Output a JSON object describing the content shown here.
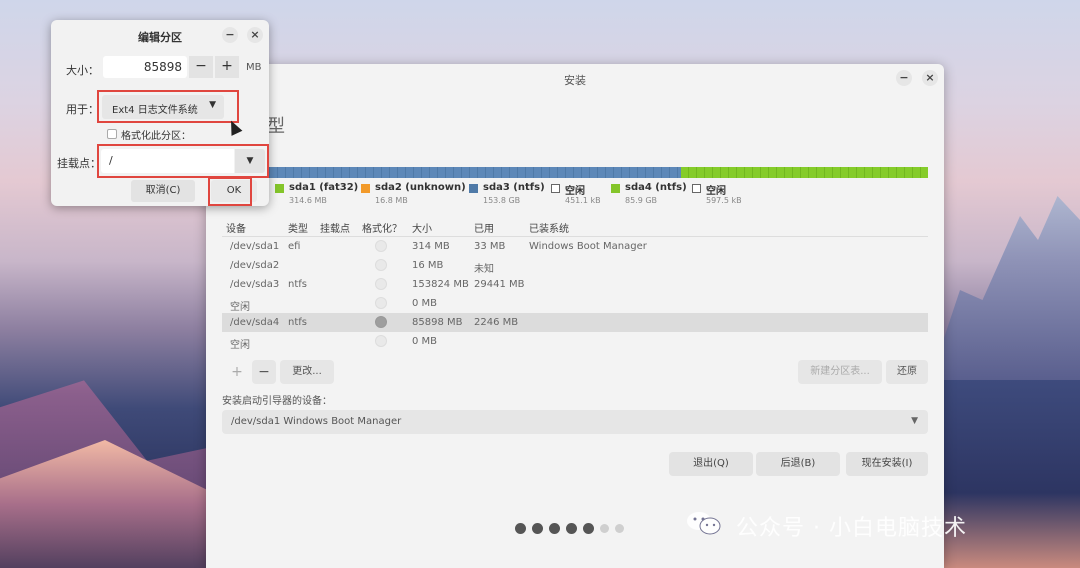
{
  "dialog": {
    "title": "编辑分区",
    "size_label": "大小：",
    "size_value": "85898",
    "size_unit": "MB",
    "minus": "−",
    "plus": "+",
    "minimize": "−",
    "close": "×",
    "use_label": "用于：",
    "use_value": "Ext4 日志文件系统",
    "format_label": "格式化此分区：",
    "format_checked": false,
    "mount_label": "挂载点：",
    "mount_value": "/",
    "cancel": "取消(C)",
    "ok": "OK"
  },
  "main": {
    "title": "安装",
    "heading": "类型",
    "minimize": "−",
    "close": "×",
    "legend": [
      {
        "name": "sda1 (fat32)",
        "size": "314.6 MB",
        "color": "#84c52a",
        "empty": false
      },
      {
        "name": "sda2 (unknown)",
        "size": "16.8 MB",
        "color": "#f29a2a",
        "empty": false
      },
      {
        "name": "sda3 (ntfs)",
        "size": "153.8 GB",
        "color": "#4f7aa8",
        "empty": false
      },
      {
        "name": "空闲",
        "size": "451.1 kB",
        "color": "#ffffff",
        "empty": true
      },
      {
        "name": "sda4 (ntfs)",
        "size": "85.9 GB",
        "color": "#84c52a",
        "empty": false
      },
      {
        "name": "空闲",
        "size": "597.5 kB",
        "color": "#ffffff",
        "empty": true
      }
    ],
    "columns": [
      "设备",
      "类型",
      "挂载点",
      "格式化？",
      "大小",
      "已用",
      "已装系统"
    ],
    "rows": [
      {
        "device": "/dev/sda1",
        "type": "efi",
        "mount": "",
        "size": "314 MB",
        "used": "33 MB",
        "system": "Windows Boot Manager"
      },
      {
        "device": "/dev/sda2",
        "type": "",
        "mount": "",
        "size": "16 MB",
        "used": "未知",
        "system": ""
      },
      {
        "device": "/dev/sda3",
        "type": "ntfs",
        "mount": "",
        "size": "153824 MB",
        "used": "29441 MB",
        "system": ""
      },
      {
        "device": "空闲",
        "type": "",
        "mount": "",
        "size": "0 MB",
        "used": "",
        "system": ""
      },
      {
        "device": "/dev/sda4",
        "type": "ntfs",
        "mount": "",
        "size": "85898 MB",
        "used": "2246 MB",
        "system": ""
      },
      {
        "device": "空闲",
        "type": "",
        "mount": "",
        "size": "0 MB",
        "used": "",
        "system": ""
      }
    ],
    "selected_row": 4,
    "toolbar": {
      "add": "+",
      "remove": "−",
      "change": "更改...",
      "new_table": "新建分区表...",
      "revert": "还原"
    },
    "boot_label": "安装启动引导器的设备：",
    "boot_value": "/dev/sda1  Windows Boot Manager",
    "quit": "退出(Q)",
    "back": "后退(B)",
    "install_now": "现在安装(I)"
  },
  "watermark": {
    "text": "公众号 · 小白电脑技术",
    "icon": "wechat-icon"
  },
  "colors": {
    "highlight_red": "#e0463f",
    "bar_blue": "#4f7aa8",
    "bar_green": "#84c52a"
  }
}
